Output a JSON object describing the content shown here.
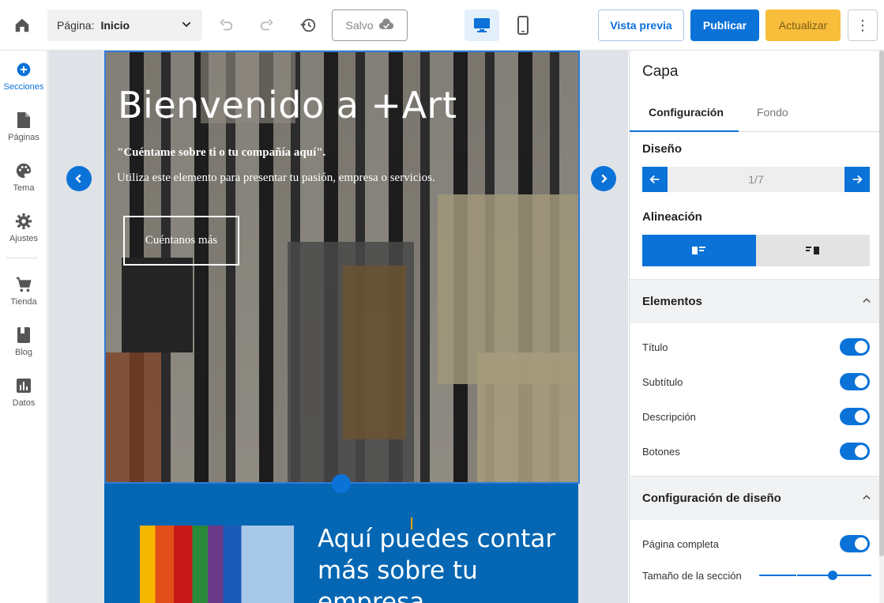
{
  "toolbar": {
    "page_label": "Página:",
    "page_value": "Inicio",
    "saved_label": "Salvo",
    "preview_label": "Vista previa",
    "publish_label": "Publicar",
    "update_label": "Actualizar",
    "more_label": "⋮"
  },
  "sidebar": {
    "items": [
      {
        "label": "Secciones",
        "icon": "plus-circle-icon"
      },
      {
        "label": "Páginas",
        "icon": "document-icon"
      },
      {
        "label": "Tema",
        "icon": "palette-icon"
      },
      {
        "label": "Ajustes",
        "icon": "gear-icon"
      },
      {
        "label": "Tienda",
        "icon": "cart-icon"
      },
      {
        "label": "Blog",
        "icon": "book-icon"
      },
      {
        "label": "Datos",
        "icon": "bar-chart-icon"
      }
    ]
  },
  "hero": {
    "title": "Bienvenido a +Art",
    "quote": "\"Cuéntame sobre ti o tu compañía aquí\".",
    "description": "Utiliza este elemento para presentar tu pasión, empresa o servicios.",
    "button_label": "Cuéntanos más"
  },
  "about": {
    "title": "Aquí puedes contar más sobre tu empresa"
  },
  "panel": {
    "title": "Capa",
    "tabs": [
      "Configuración",
      "Fondo"
    ],
    "design_label": "Diseño",
    "pager_value": "1/7",
    "alignment_label": "Alineación",
    "elements_group": "Elementos",
    "elements": [
      "Título",
      "Subtítulo",
      "Descripción",
      "Botones"
    ],
    "layout_group": "Configuración de diseño",
    "full_page_label": "Página completa",
    "section_size_label": "Tamaño de la sección"
  },
  "colors": {
    "accent": "#0b72d8",
    "update_button": "#f8bd3b",
    "about_bg": "#0567b3"
  }
}
